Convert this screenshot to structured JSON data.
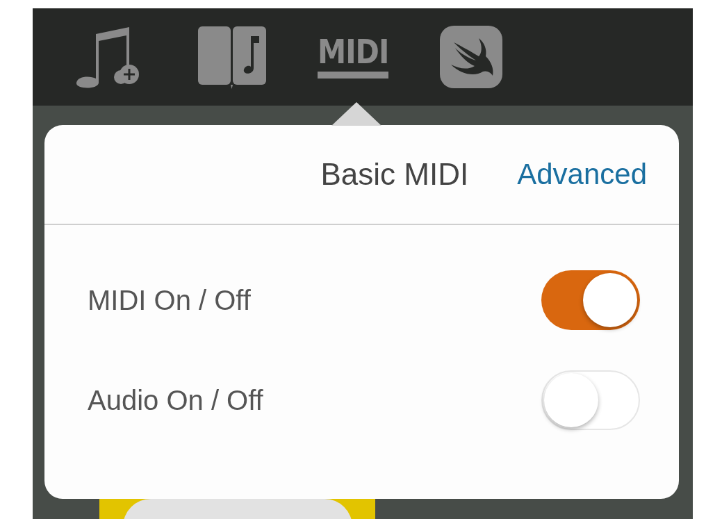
{
  "toolbar": {
    "midi_logo": "MIDI"
  },
  "popover": {
    "title": "Basic MIDI",
    "action": "Advanced",
    "rows": [
      {
        "label": "MIDI On / Off",
        "on": true
      },
      {
        "label": "Audio On / Off",
        "on": false
      }
    ]
  }
}
